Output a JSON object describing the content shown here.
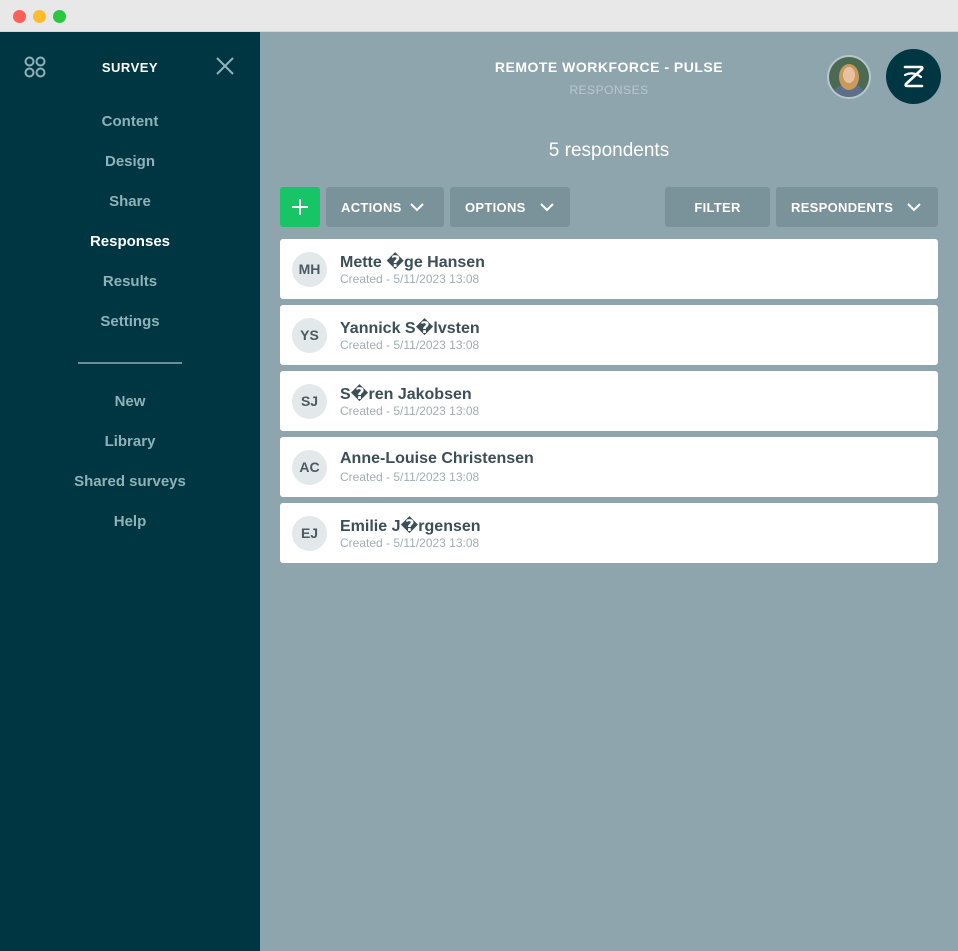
{
  "sidebar": {
    "title": "SURVEY",
    "items": [
      {
        "label": "Content",
        "active": false
      },
      {
        "label": "Design",
        "active": false
      },
      {
        "label": "Share",
        "active": false
      },
      {
        "label": "Responses",
        "active": true
      },
      {
        "label": "Results",
        "active": false
      },
      {
        "label": "Settings",
        "active": false
      }
    ],
    "secondary_items": [
      {
        "label": "New"
      },
      {
        "label": "Library"
      },
      {
        "label": "Shared surveys"
      },
      {
        "label": "Help"
      }
    ]
  },
  "header": {
    "title": "REMOTE WORKFORCE - PULSE",
    "subtitle": "RESPONSES"
  },
  "main": {
    "respondent_count": "5 respondents",
    "toolbar": {
      "actions_label": "ACTIONS",
      "options_label": "OPTIONS",
      "filter_label": "FILTER",
      "respondents_label": "RESPONDENTS"
    },
    "respondents": [
      {
        "initials": "MH",
        "name": "Mette �ge Hansen",
        "created": "Created - 5/11/2023 13:08"
      },
      {
        "initials": "YS",
        "name": "Yannick S�lvsten",
        "created": "Created - 5/11/2023 13:08"
      },
      {
        "initials": "SJ",
        "name": "S�ren Jakobsen",
        "created": "Created - 5/11/2023 13:08"
      },
      {
        "initials": "AC",
        "name": "Anne-Louise Christensen",
        "created": "Created - 5/11/2023 13:08"
      },
      {
        "initials": "EJ",
        "name": "Emilie J�rgensen",
        "created": "Created - 5/11/2023 13:08"
      }
    ]
  },
  "colors": {
    "sidebar_bg": "#003642",
    "main_bg": "#8ea5ad",
    "accent_green": "#17c566",
    "toolbar_button": "#7a939b"
  },
  "icons": {
    "apps": "apps-grid-icon",
    "close": "close-icon",
    "add": "plus-icon",
    "dropdown": "chevron-down-icon",
    "logo": "brand-logo-icon"
  }
}
